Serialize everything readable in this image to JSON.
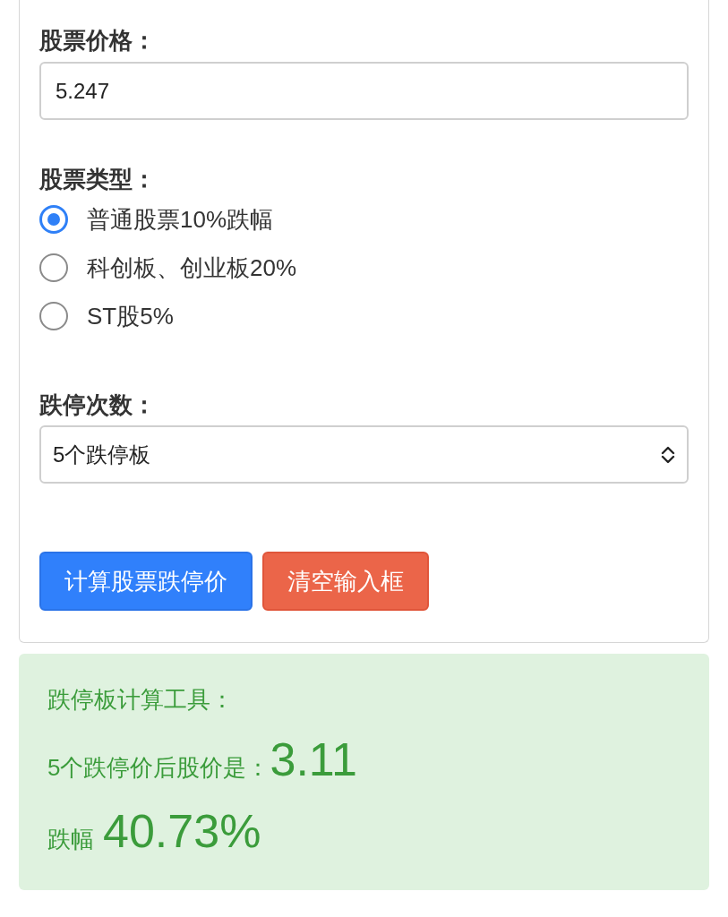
{
  "form": {
    "price": {
      "label": "股票价格：",
      "value": "5.247"
    },
    "stock_type": {
      "label": "股票类型：",
      "options": [
        {
          "label": "普通股票10%跌幅",
          "selected": true
        },
        {
          "label": "科创板、创业板20%",
          "selected": false
        },
        {
          "label": "ST股5%",
          "selected": false
        }
      ]
    },
    "limit_down_count": {
      "label": "跌停次数：",
      "value": "5个跌停板"
    },
    "buttons": [
      {
        "label": "计算股票跌停价",
        "kind": "primary"
      },
      {
        "label": "清空输入框",
        "kind": "danger"
      }
    ]
  },
  "result": {
    "title": "跌停板计算工具：",
    "price_label": "5个跌停价后股价是：",
    "price_value": "3.11",
    "drop_label": "跌幅",
    "drop_value": "40.73%"
  }
}
